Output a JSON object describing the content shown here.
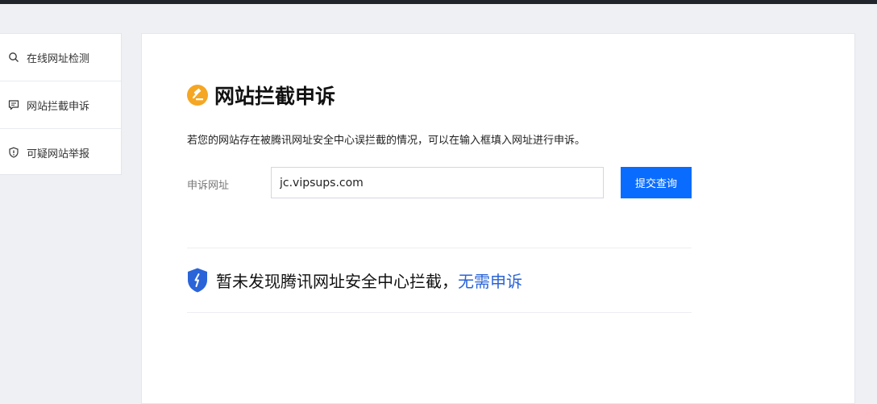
{
  "sidebar": {
    "items": [
      {
        "label": "在线网址检测",
        "icon": "search-icon"
      },
      {
        "label": "网站拦截申诉",
        "icon": "chat-icon"
      },
      {
        "label": "可疑网站举报",
        "icon": "shield-alert-icon"
      }
    ]
  },
  "main": {
    "title": "网站拦截申诉",
    "title_icon": "gavel-icon",
    "description": "若您的网站存在被腾讯网址安全中心误拦截的情况，可以在输入框填入网址进行申诉。",
    "form": {
      "label": "申诉网址",
      "input_value": "jc.vipsups.com",
      "submit_label": "提交查询"
    },
    "result": {
      "icon": "shield-icon",
      "text": "暂未发现腾讯网址安全中心拦截，",
      "link_text": "无需申诉"
    }
  },
  "colors": {
    "accent": "#0a6cff",
    "link": "#2a64d8",
    "title_icon": "#f5a623",
    "shield": "#2a64d8"
  }
}
